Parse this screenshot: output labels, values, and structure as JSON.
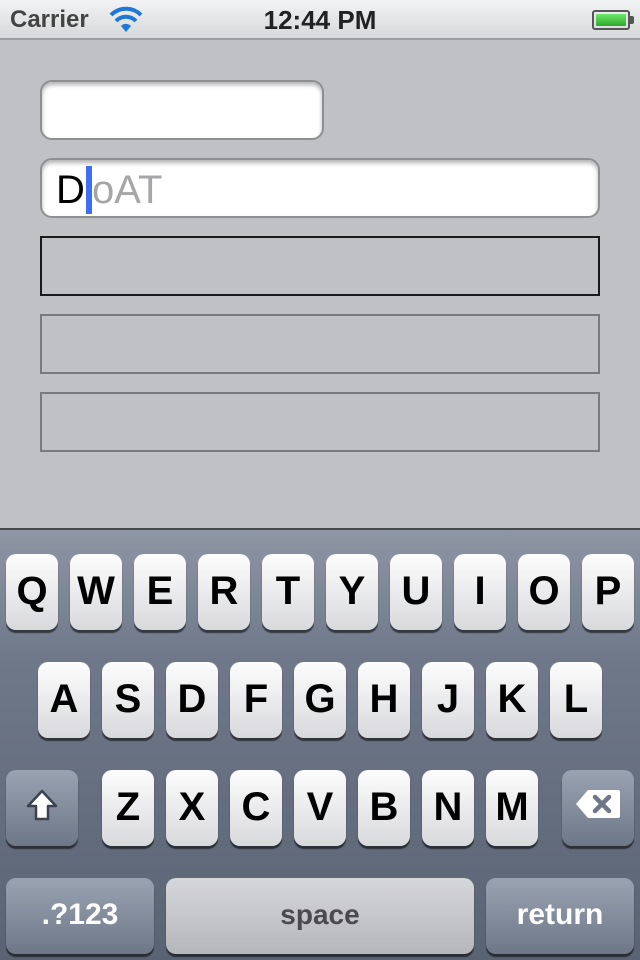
{
  "status_bar": {
    "carrier": "Carrier",
    "time": "12:44 PM",
    "wifi_icon": "wifi-icon",
    "battery_icon": "battery-icon",
    "battery_color": "#3fc63c"
  },
  "form": {
    "field2_value": "D",
    "field2_placeholder_tail": "oAT",
    "cursor_color": "#3f6ef2"
  },
  "keyboard": {
    "row1": [
      "Q",
      "W",
      "E",
      "R",
      "T",
      "Y",
      "U",
      "I",
      "O",
      "P"
    ],
    "row2": [
      "A",
      "S",
      "D",
      "F",
      "G",
      "H",
      "J",
      "K",
      "L"
    ],
    "row3": [
      "Z",
      "X",
      "C",
      "V",
      "B",
      "N",
      "M"
    ],
    "shift_icon": "shift-arrow-icon",
    "delete_icon": "backspace-icon",
    "numbers_label": ".?123",
    "space_label": "space",
    "return_label": "return"
  }
}
